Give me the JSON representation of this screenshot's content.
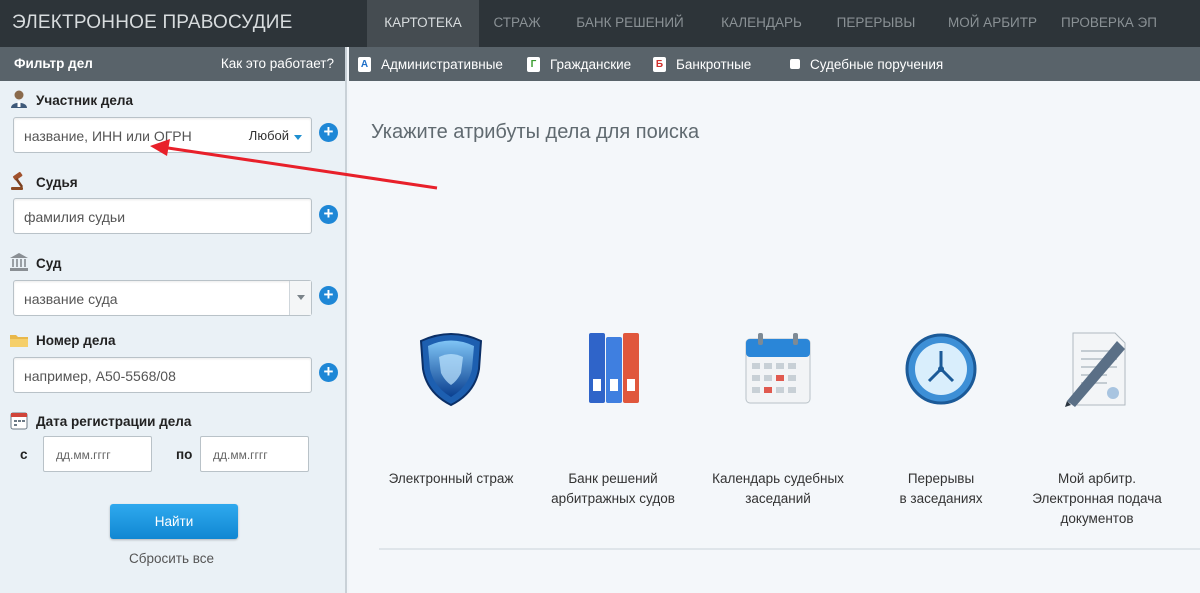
{
  "app": {
    "title": "ЭЛЕКТРОННОЕ ПРАВОСУДИЕ",
    "nav": [
      "КАРТОТЕКА",
      "СТРАЖ",
      "БАНК РЕШЕНИЙ",
      "КАЛЕНДАРЬ",
      "ПЕРЕРЫВЫ",
      "МОЙ АРБИТР",
      "ПРОВЕРКА ЭП"
    ],
    "active_nav": "КАРТОТЕКА"
  },
  "filter": {
    "title": "Фильтр дел",
    "how_link": "Как это работает?",
    "participant": {
      "label": "Участник дела",
      "placeholder": "название, ИНН или ОГРН",
      "mode": "Любой"
    },
    "judge": {
      "label": "Судья",
      "placeholder": "фамилия судьи"
    },
    "court": {
      "label": "Суд",
      "placeholder": "название суда"
    },
    "case_number": {
      "label": "Номер дела",
      "placeholder": "например, А50-5568/08"
    },
    "reg_date": {
      "label": "Дата регистрации дела",
      "from_label": "с",
      "to_label": "по",
      "from_placeholder": "дд.мм.гггг",
      "to_placeholder": "дд.мм.гггг"
    },
    "search_button": "Найти",
    "reset_link": "Сбросить все"
  },
  "case_types": {
    "admin": {
      "badge": "А",
      "label": "Административные",
      "color": "#1e6fc8"
    },
    "civil": {
      "badge": "Г",
      "label": "Гражданские",
      "color": "#3a9b2f"
    },
    "bankrupt": {
      "badge": "Б",
      "label": "Банкротные",
      "color": "#d0312d"
    },
    "orders": {
      "label": "Судебные поручения"
    }
  },
  "main": {
    "prompt": "Укажите атрибуты дела для поиска",
    "services": [
      {
        "icon": "shield-icon",
        "caption_1": "Электронный страж",
        "caption_2": "",
        "caption_3": ""
      },
      {
        "icon": "binders-icon",
        "caption_1": "Банк решений",
        "caption_2": "арбитражных судов",
        "caption_3": ""
      },
      {
        "icon": "calendar-icon",
        "caption_1": "Календарь судебных",
        "caption_2": "заседаний",
        "caption_3": ""
      },
      {
        "icon": "clock-icon",
        "caption_1": "Перерывы",
        "caption_2": "в заседаниях",
        "caption_3": ""
      },
      {
        "icon": "document-pen-icon",
        "caption_1": "Мой арбитр.",
        "caption_2": "Электронная подача",
        "caption_3": "документов"
      }
    ]
  },
  "colors": {
    "topbar": "#2d3439",
    "panel_header": "#59636a",
    "accent": "#1e87d6",
    "annotation_arrow": "#e8202a"
  }
}
